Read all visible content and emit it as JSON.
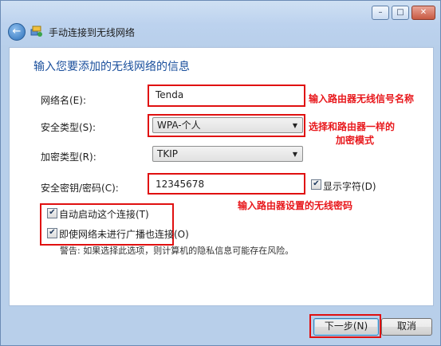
{
  "window": {
    "title": "手动连接到无线网络",
    "controls": {
      "minimize": "–",
      "maximize": "□",
      "close": "✕"
    },
    "back_icon": "back-arrow-icon",
    "net_icon": "network-wizard-icon"
  },
  "form": {
    "heading": "输入您要添加的无线网络的信息",
    "network_name_label": "网络名(E):",
    "network_name_value": "Tenda",
    "security_type_label": "安全类型(S):",
    "security_type_value": "WPA-个人",
    "encryption_type_label": "加密类型(R):",
    "encryption_type_value": "TKIP",
    "key_label": "安全密钥/密码(C):",
    "key_value": "12345678",
    "show_chars_label": "显示字符(D)",
    "show_chars_checked": true,
    "auto_start_label": "自动启动这个连接(T)",
    "auto_start_checked": true,
    "connect_hidden_label": "即使网络未进行广播也连接(O)",
    "connect_hidden_checked": true,
    "warning": "警告: 如果选择此选项，则计算机的隐私信息可能存在风险。"
  },
  "annotations": {
    "name_note": "输入路由器无线信号名称",
    "security_note_line1": "选择和路由器一样的",
    "security_note_line2": "加密模式",
    "key_note": "输入路由器设置的无线密码",
    "color": "#e8181c"
  },
  "buttons": {
    "next": "下一步(N)",
    "cancel": "取消"
  }
}
